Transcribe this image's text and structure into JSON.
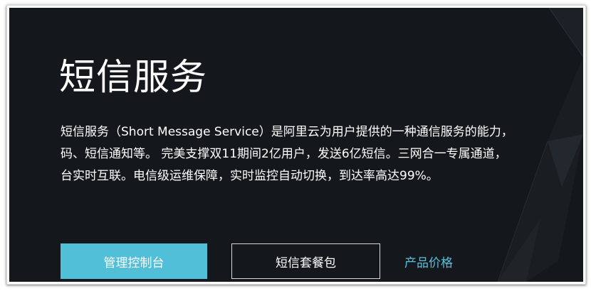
{
  "hero": {
    "title": "短信服务",
    "description_lines": [
      "短信服务（Short Message Service）是阿里云为用户提供的一种通信服务的能力，",
      "码、短信通知等。 完美支撑双11期间2亿用户，发送6亿短信。三网合一专属通道，",
      "台实时互联。电信级运维保障，实时监控自动切换，到达率高达99%。"
    ]
  },
  "actions": {
    "primary_label": "管理控制台",
    "secondary_label": "短信套餐包",
    "link_label": "产品价格"
  },
  "colors": {
    "hero_background": "#14171b",
    "primary_button": "#52bfd9",
    "link": "#55c2dd"
  }
}
